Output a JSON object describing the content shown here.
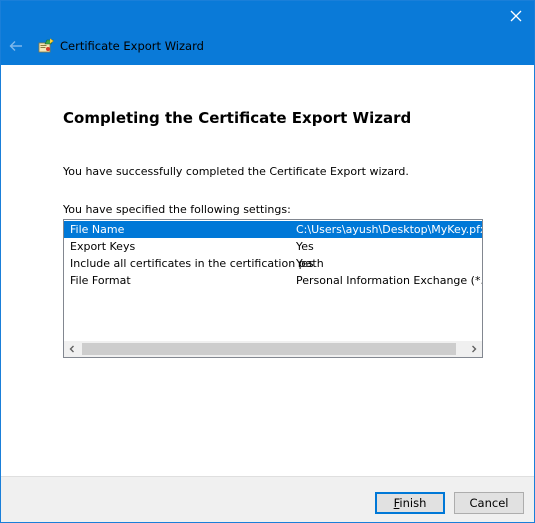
{
  "window": {
    "title": "Certificate Export Wizard",
    "colors": {
      "titlebar": "#0a7ad8",
      "selection": "#0078d7"
    }
  },
  "icons": {
    "close": "close-icon",
    "back": "back-arrow-icon",
    "wizard": "certificate-wizard-icon",
    "scroll_left": "scroll-left-icon",
    "scroll_right": "scroll-right-icon"
  },
  "main": {
    "heading": "Completing the Certificate Export Wizard",
    "success_text": "You have successfully completed the Certificate Export wizard.",
    "settings_label": "You have specified the following settings:",
    "settings": [
      {
        "key": "File Name",
        "value": "C:\\Users\\ayush\\Desktop\\MyKey.pfx",
        "selected": true
      },
      {
        "key": "Export Keys",
        "value": "Yes",
        "selected": false
      },
      {
        "key": "Include all certificates in the certification path",
        "value": "Yes",
        "selected": false
      },
      {
        "key": "File Format",
        "value": "Personal Information Exchange (*.pfx)",
        "selected": false
      }
    ]
  },
  "footer": {
    "finish_label": "Finish",
    "cancel_label": "Cancel"
  }
}
